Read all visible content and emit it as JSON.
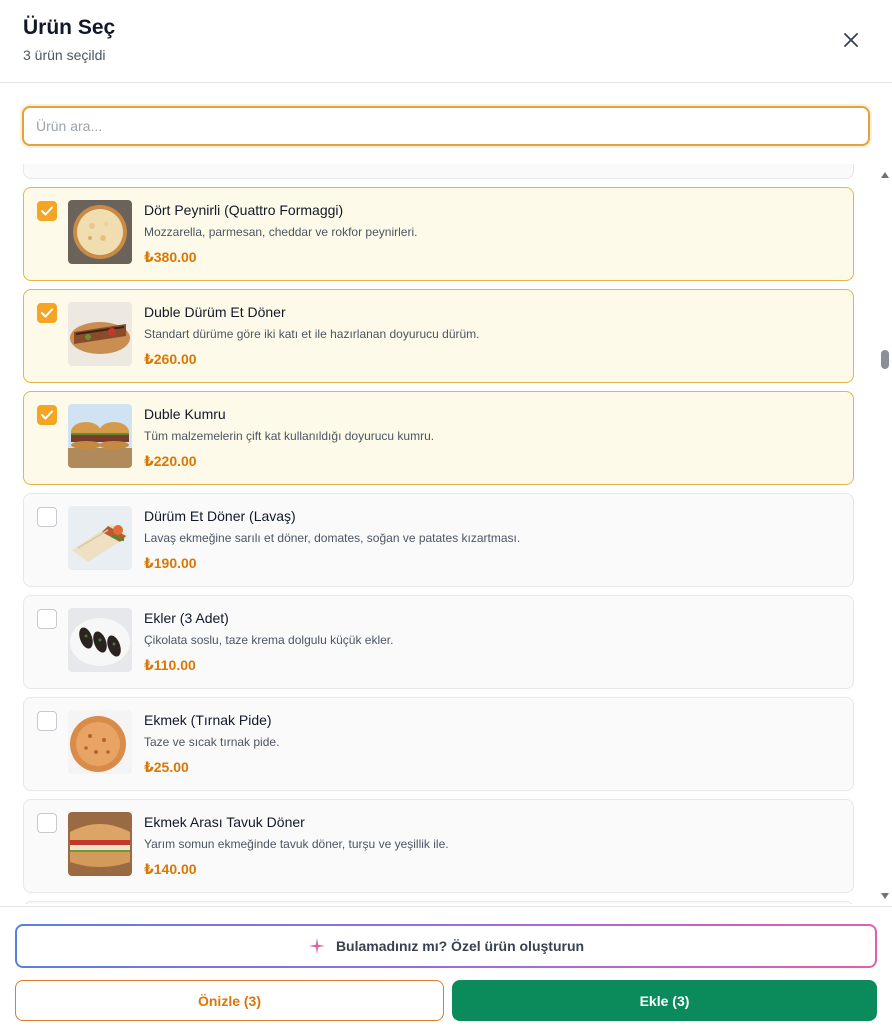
{
  "header": {
    "title": "Ürün Seç",
    "subtitle": "3 ürün seçildi",
    "close_icon": "close-icon"
  },
  "search": {
    "placeholder": "Ürün ara...",
    "value": ""
  },
  "colors": {
    "accent": "#f5a524",
    "price": "#d97706",
    "selected_bg": "#fefae9",
    "primary_button": "#0b8a5c"
  },
  "products": [
    {
      "name": "Dört Peynirli (Quattro Formaggi)",
      "description": "Mozzarella, parmesan, cheddar ve rokfor peynirleri.",
      "price": "₺380.00",
      "selected": true,
      "image": "pizza-image"
    },
    {
      "name": "Duble Dürüm Et Döner",
      "description": "Standart dürüme göre iki katı et ile hazırlanan doyurucu dürüm.",
      "price": "₺260.00",
      "selected": true,
      "image": "wrap-image"
    },
    {
      "name": "Duble Kumru",
      "description": "Tüm malzemelerin çift kat kullanıldığı doyurucu kumru.",
      "price": "₺220.00",
      "selected": true,
      "image": "sandwich-image"
    },
    {
      "name": "Dürüm Et Döner (Lavaş)",
      "description": "Lavaş ekmeğine sarılı et döner, domates, soğan ve patates kızartması.",
      "price": "₺190.00",
      "selected": false,
      "image": "wrap-image"
    },
    {
      "name": "Ekler (3 Adet)",
      "description": "Çikolata soslu, taze krema dolgulu küçük ekler.",
      "price": "₺110.00",
      "selected": false,
      "image": "eclair-image"
    },
    {
      "name": "Ekmek (Tırnak Pide)",
      "description": "Taze ve sıcak tırnak pide.",
      "price": "₺25.00",
      "selected": false,
      "image": "bread-image"
    },
    {
      "name": "Ekmek Arası Tavuk Döner",
      "description": "Yarım somun ekmeğinde tavuk döner, turşu ve yeşillik ile.",
      "price": "₺140.00",
      "selected": false,
      "image": "sandwich-image"
    }
  ],
  "footer": {
    "custom_label": "Bulamadınız mı? Özel ürün oluşturun",
    "preview_label": "Önizle (3)",
    "add_label": "Ekle (3)"
  }
}
